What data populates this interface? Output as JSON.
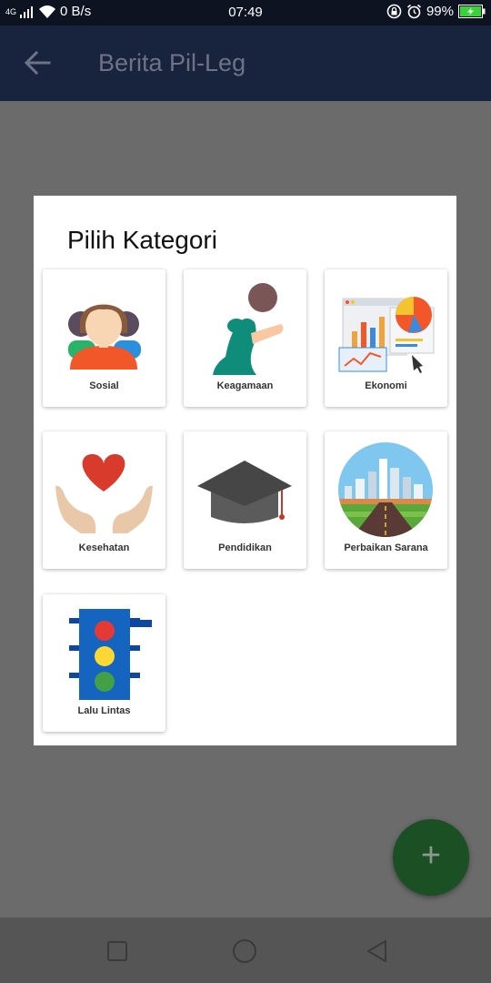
{
  "status": {
    "network_type": "4G",
    "speed": "0 B/s",
    "time": "07:49",
    "battery": "99%"
  },
  "appbar": {
    "title": "Berita Pil-Leg",
    "back_icon": "arrow-left-icon"
  },
  "dialog": {
    "title": "Pilih Kategori",
    "categories": [
      {
        "label": "Sosial",
        "icon": "people-icon"
      },
      {
        "label": "Keagamaan",
        "icon": "praying-person-icon"
      },
      {
        "label": "Ekonomi",
        "icon": "economy-chart-icon"
      },
      {
        "label": "Kesehatan",
        "icon": "heart-hands-icon"
      },
      {
        "label": "Pendidikan",
        "icon": "graduation-cap-icon"
      },
      {
        "label": "Perbaikan Sarana",
        "icon": "city-road-icon"
      },
      {
        "label": "Lalu Lintas",
        "icon": "traffic-light-icon"
      }
    ]
  },
  "fab": {
    "symbol": "+",
    "icon": "plus-icon"
  },
  "nav": {
    "icons": [
      "square-recents-icon",
      "circle-home-icon",
      "triangle-back-icon"
    ]
  },
  "colors": {
    "appbar": "#18243e",
    "statusbar": "#0e1322",
    "scrim": "#6b6b6b",
    "fab": "#1b4f24"
  }
}
